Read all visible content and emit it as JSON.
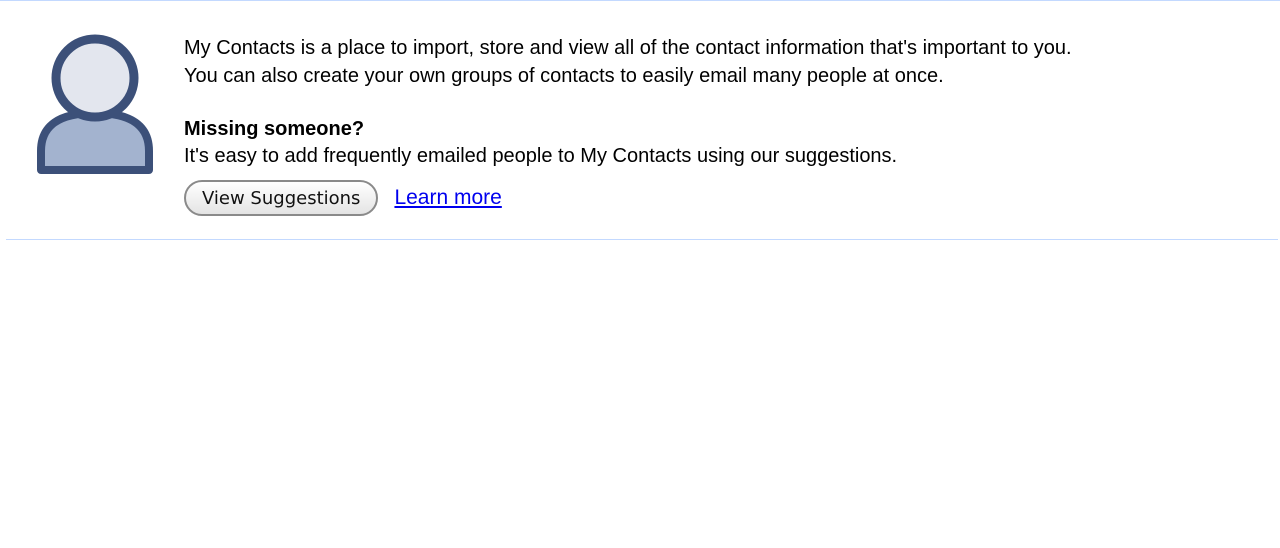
{
  "colors": {
    "divider": "#c3d9ff",
    "avatar_fill": "#3c5079",
    "avatar_head": "#e3e6ee",
    "avatar_body": "#a3b3cf",
    "link": "#0000ee"
  },
  "icons": {
    "avatar": "person-silhouette-icon"
  },
  "intro": {
    "line1": "My Contacts is a place to import, store and view all of the contact information that's important to you.",
    "line2": "You can also create your own groups of contacts to easily email many people at once."
  },
  "missing": {
    "title": "Missing someone?",
    "text": "It's easy to add frequently emailed people to My Contacts using our suggestions."
  },
  "actions": {
    "view_suggestions": "View Suggestions",
    "learn_more": "Learn more"
  }
}
